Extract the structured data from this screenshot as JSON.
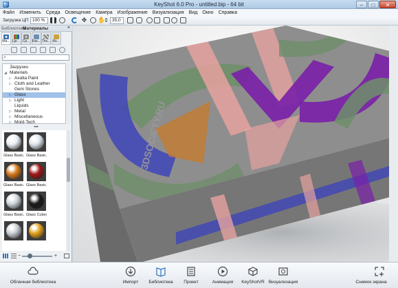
{
  "window": {
    "title": "KeyShot 6.0 Pro  - untitled.bip  - 64 bit",
    "min": "–",
    "max": "□",
    "close": "✕"
  },
  "menu": [
    "Файл",
    "Изменить",
    "Среда",
    "Освещение",
    "Камера",
    "Изображение",
    "Визуализация",
    "Вид",
    "Окно",
    "Справка"
  ],
  "toolbar": {
    "cpu_label": "Загрузка ЦП",
    "cpu_value": "100 %",
    "fov_value": "35,0"
  },
  "panel": {
    "header_left": "Библиотека",
    "header_title": "Материалы",
    "close": "×",
    "tabs": [
      "Ма...",
      "Це...",
      "Ср...",
      "Бэк...",
      "Тек...",
      "Из..."
    ],
    "tree": [
      {
        "label": "Загрузки",
        "indent": 0,
        "italic": true
      },
      {
        "label": "Materials",
        "indent": 0,
        "expanded": true
      },
      {
        "label": "Axalta Paint",
        "indent": 1,
        "collapsed": true
      },
      {
        "label": "Cloth and Leather",
        "indent": 1,
        "collapsed": true
      },
      {
        "label": "Gem Stones",
        "indent": 1
      },
      {
        "label": "Glass",
        "indent": 1,
        "selected": true,
        "collapsed": true
      },
      {
        "label": "Light",
        "indent": 1,
        "collapsed": true
      },
      {
        "label": "Liquids",
        "indent": 1
      },
      {
        "label": "Metal",
        "indent": 1,
        "collapsed": true
      },
      {
        "label": "Miscellaneous",
        "indent": 1,
        "collapsed": true
      },
      {
        "label": "Mold-Tech",
        "indent": 1,
        "collapsed": true
      }
    ],
    "splitter": "•••",
    "thumbs": [
      {
        "label": "Glass Basic...",
        "color": "#e8eef4"
      },
      {
        "label": "Glass Basic...",
        "color": "#dde4ea"
      },
      {
        "label": "Glass Basic...",
        "color": "#d97a1c"
      },
      {
        "label": "Glass Basic...",
        "color": "#a01818"
      },
      {
        "label": "Glass Basic...",
        "color": "#d0d6dc"
      },
      {
        "label": "Glass Cubes...",
        "color": "#1a1a1a"
      },
      {
        "label": "",
        "color": "#c8ced4"
      },
      {
        "label": "",
        "color": "#e0a01a"
      }
    ]
  },
  "viewport": {
    "watermark": "3DSOCIETY.RU"
  },
  "dock": {
    "cloud": "Облачная библиотека",
    "items": [
      "Импорт",
      "Библиотека",
      "Проект",
      "Анимация",
      "KeyShotVR",
      "Визуализация"
    ],
    "screenshot": "Снимок экрана"
  },
  "colors": {
    "accent": "#2f74c0",
    "box_top": "#8c8c8c",
    "box_side": "#747474",
    "purple": "#7a1fa8",
    "salmon": "#e6a2a0",
    "green": "#6f8f6a",
    "orange": "#c77a2a",
    "blue": "#3f46b8"
  }
}
